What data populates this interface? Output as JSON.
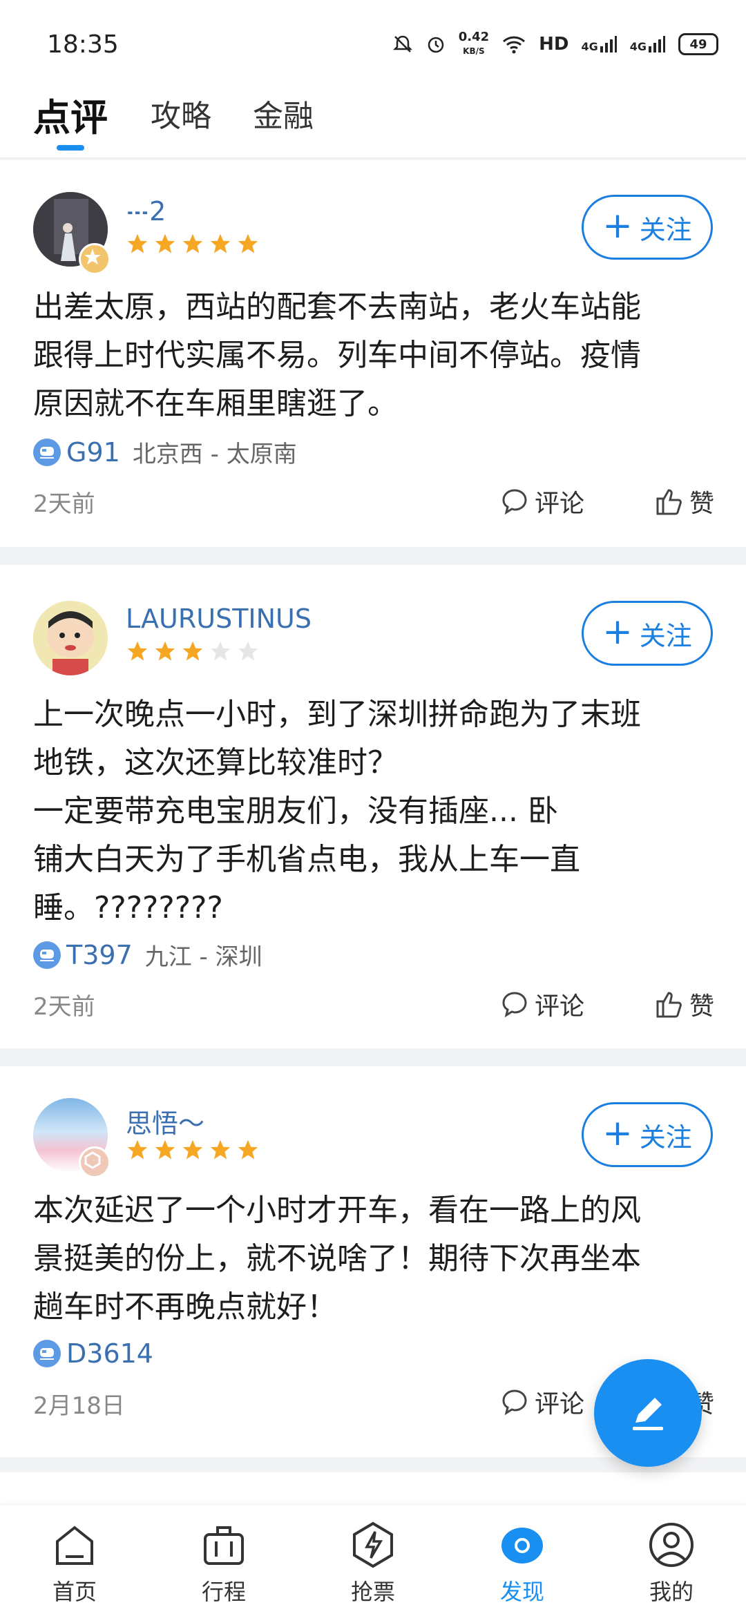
{
  "status": {
    "time": "18:35",
    "net_speed_value": "0.42",
    "net_speed_unit": "KB/S",
    "hd": "HD",
    "sig1": "4G",
    "sig2": "4G",
    "battery": "49"
  },
  "tabs": [
    {
      "label": "点评",
      "active": true
    },
    {
      "label": "攻略",
      "active": false
    },
    {
      "label": "金融",
      "active": false
    }
  ],
  "posts": [
    {
      "user": "𝌀2",
      "rating": 5,
      "follow": "关注",
      "content": "出差太原，西站的配套不去南站，老火车站能\n跟得上时代实属不易。列车中间不停站。疫情\n原因就不在车厢里瞎逛了。",
      "train": "G91",
      "route": "北京西 - 太原南",
      "time": "2天前",
      "comment": "评论",
      "like": "赞"
    },
    {
      "user": "LAURUSTINUS",
      "rating": 3,
      "follow": "关注",
      "content": "上一次晚点一小时，到了深圳拼命跑为了末班\n地铁，这次还算比较准时？\n一定要带充电宝朋友们，没有插座... 卧\n铺大白天为了手机省点电，我从上车一直\n睡。????????",
      "train": "T397",
      "route": "九江 - 深圳",
      "time": "2天前",
      "comment": "评论",
      "like": "赞"
    },
    {
      "user": "思悟～",
      "rating": 5,
      "follow": "关注",
      "content": "本次延迟了一个小时才开车，看在一路上的风\n景挺美的份上，就不说啥了！期待下次再坐本\n趟车时不再晚点就好！",
      "train": "D3614",
      "route": "",
      "time": "2月18日",
      "comment": "评论",
      "like": "赞"
    }
  ],
  "bottom_nav": [
    {
      "label": "首页",
      "icon": "home-icon",
      "active": false
    },
    {
      "label": "行程",
      "icon": "luggage-icon",
      "active": false
    },
    {
      "label": "抢票",
      "icon": "lightning-icon",
      "active": false
    },
    {
      "label": "发现",
      "icon": "discover-icon",
      "active": true
    },
    {
      "label": "我的",
      "icon": "profile-icon",
      "active": false
    }
  ],
  "colors": {
    "accent": "#1a8ff2",
    "star": "#f5a623",
    "star_empty": "#e6e6e6"
  }
}
